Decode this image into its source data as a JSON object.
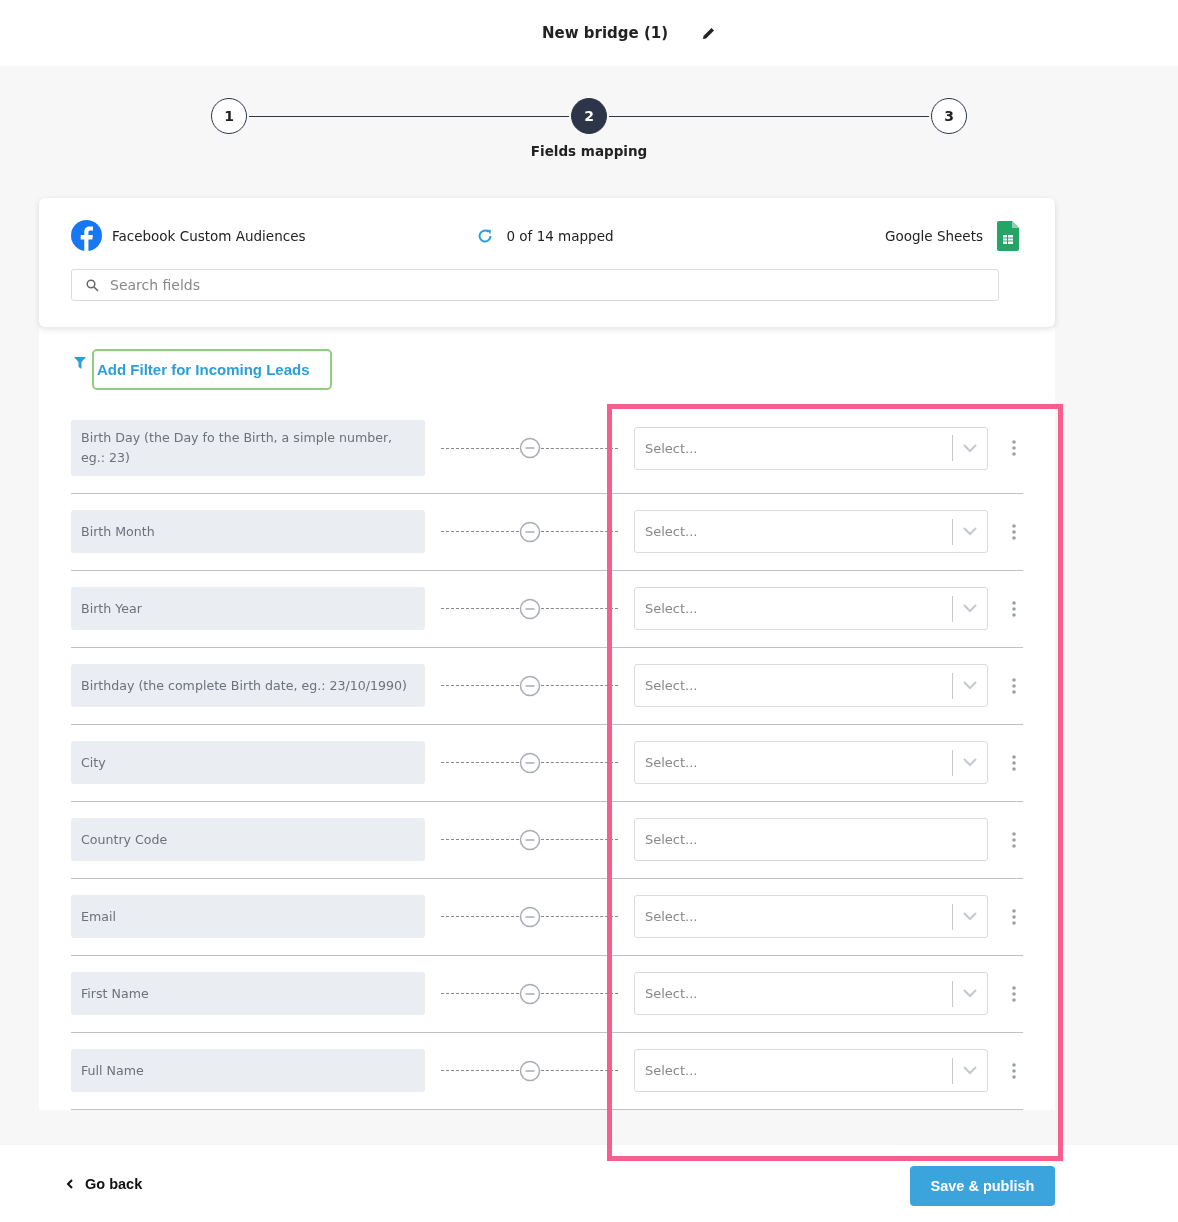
{
  "header": {
    "title": "New bridge (1)"
  },
  "steps": [
    {
      "number": "1",
      "selected": false
    },
    {
      "number": "2",
      "label": "Fields mapping",
      "selected": true
    },
    {
      "number": "3",
      "selected": false
    }
  ],
  "summary": {
    "source": "Facebook Custom Audiences",
    "status": "0 of 14 mapped",
    "destination": "Google Sheets"
  },
  "search": {
    "placeholder": "Search fields"
  },
  "filter": {
    "label": "Add Filter for Incoming Leads"
  },
  "mappings": [
    {
      "field": "Birth Day (the Day fo the Birth, a simple number, eg.: 23)",
      "placeholder": "Select...",
      "indicator": true
    },
    {
      "field": "Birth Month",
      "placeholder": "Select...",
      "indicator": true
    },
    {
      "field": "Birth Year",
      "placeholder": "Select...",
      "indicator": true
    },
    {
      "field": "Birthday (the complete Birth date, eg.: 23/10/1990)",
      "placeholder": "Select...",
      "indicator": true
    },
    {
      "field": "City",
      "placeholder": "Select...",
      "indicator": true
    },
    {
      "field": "Country Code",
      "placeholder": "Select...",
      "indicator": false
    },
    {
      "field": "Email",
      "placeholder": "Select...",
      "indicator": true
    },
    {
      "field": "First Name",
      "placeholder": "Select...",
      "indicator": true
    },
    {
      "field": "Full Name",
      "placeholder": "Select...",
      "indicator": true
    }
  ],
  "footer": {
    "back": "Go back",
    "save": "Save & publish"
  }
}
